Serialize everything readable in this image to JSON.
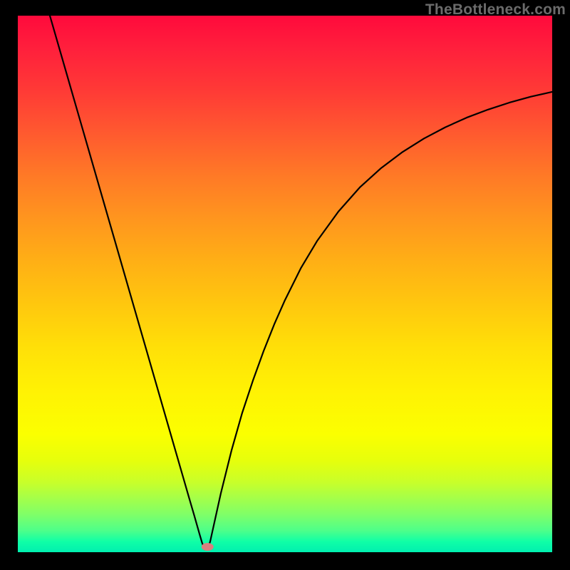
{
  "watermark": "TheBottleneck.com",
  "chart_data": {
    "type": "line",
    "title": "",
    "xlabel": "",
    "ylabel": "",
    "xlim": [
      0,
      100
    ],
    "ylim": [
      0,
      100
    ],
    "grid": false,
    "legend": false,
    "notch_x": 35,
    "marker": {
      "x": 35.5,
      "y": 1.0,
      "color": "#d97f7f"
    },
    "series": [
      {
        "name": "curve",
        "color": "#000000",
        "x": [
          6,
          8,
          10,
          12,
          14,
          16,
          18,
          20,
          22,
          24,
          26,
          28,
          30,
          32,
          33,
          34,
          34.5,
          35,
          35.5,
          36,
          37,
          38,
          40,
          42,
          44,
          46,
          48,
          50,
          53,
          56,
          60,
          64,
          68,
          72,
          76,
          80,
          84,
          88,
          92,
          96,
          100
        ],
        "y": [
          100,
          93.1,
          86.2,
          79.3,
          72.4,
          65.5,
          58.6,
          51.7,
          44.8,
          37.9,
          31.0,
          24.1,
          17.2,
          10.3,
          6.9,
          3.4,
          1.7,
          0.5,
          0.5,
          2.0,
          6.5,
          11.0,
          19.0,
          26.0,
          32.0,
          37.5,
          42.5,
          47.0,
          53.0,
          58.0,
          63.5,
          68.0,
          71.6,
          74.6,
          77.1,
          79.2,
          81.0,
          82.5,
          83.8,
          84.9,
          85.8
        ]
      }
    ]
  }
}
